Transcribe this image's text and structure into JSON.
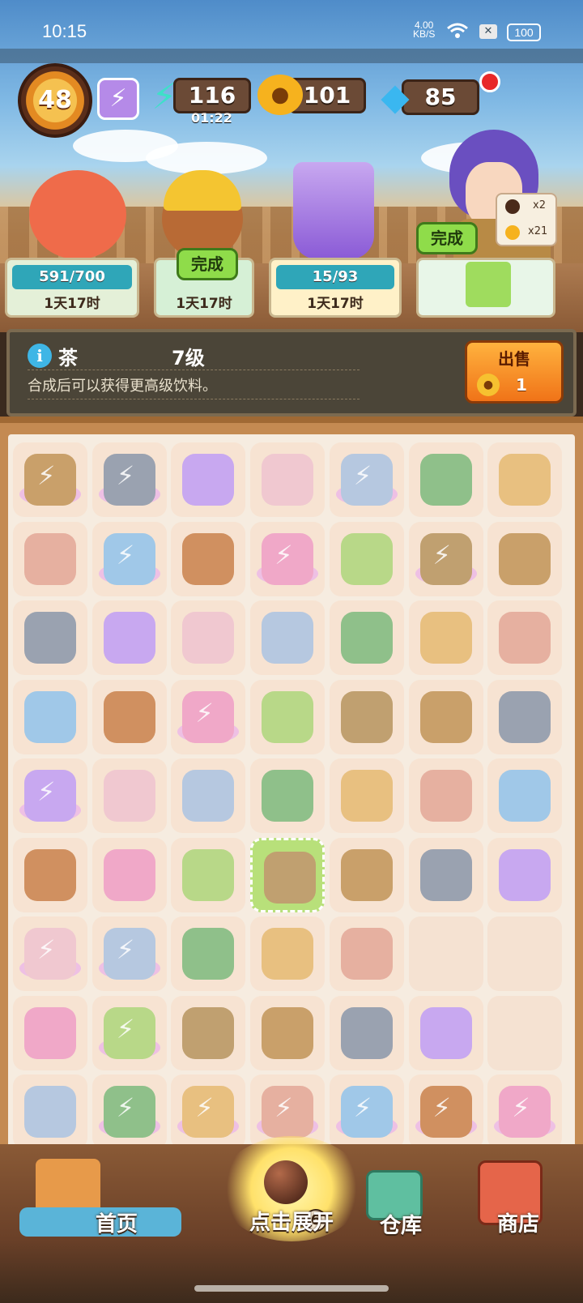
{
  "status_bar": {
    "time": "10:15",
    "net_speed": "4.00",
    "net_unit": "KB/S",
    "battery": "100"
  },
  "resources": {
    "level": "48",
    "energy": "116",
    "energy_timer": "01:22",
    "paw_coins": "101",
    "gems": "85"
  },
  "orders": {
    "chip_item_1": "x2",
    "chip_item_2": "x21",
    "done_label": "完成",
    "cards": [
      {
        "progress": "591/700",
        "time": "1天17时"
      },
      {
        "progress": "完成",
        "time": "1天17时"
      },
      {
        "progress": "15/93",
        "time": "1天17时"
      },
      {
        "progress": "",
        "time": ""
      }
    ]
  },
  "info": {
    "name": "茶",
    "level": "7级",
    "description": "合成后可以获得更高级饮料。",
    "sell_label": "出售",
    "sell_value": "1"
  },
  "board": {
    "rows": [
      [
        "wooden-bucket-generator",
        "bbq-grill-generator",
        "vending-machine",
        "cat-keychain",
        "bow-generator",
        "green-vase",
        "photo-album"
      ],
      [
        "perfume-bottle",
        "cotton-candy-generator",
        "wings",
        "bonsai-generator",
        "hand-saw",
        "wooden-tub-generator",
        "glove"
      ],
      [
        "yellow-cloth",
        "screw",
        "fox-keychain",
        "slingshot",
        "starfish",
        "metal-grill",
        "green-sack"
      ],
      [
        "chocolate-tray",
        "fish",
        "red-vending-generator",
        "battery",
        "thread-spool",
        "wood-plank",
        "string"
      ],
      [
        "paint-bucket-generator",
        "slinky",
        "wood-pieces",
        "shell",
        "cookie-pile",
        "hand-saw-2",
        "paper-scraps"
      ],
      [
        "lipstick",
        "gold-pouch",
        "rake",
        "teapot",
        "scraper",
        "paw-cookie",
        "dustpan"
      ],
      [
        "bow-generator-2",
        "pink-vending-generator",
        "axe",
        "battery-small",
        "cat-towel",
        "empty",
        "empty"
      ],
      [
        "green-sack-glow",
        "bbq-grill-generator-2",
        "fish-2",
        "crab",
        "cookie-pile-2",
        "cola-can",
        "empty"
      ],
      [
        "glass-vase",
        "sand-castle-generator",
        "cotton-candy-generator-2",
        "window-generator",
        "cotton-candy-generator-3",
        "chest-generator",
        "treasure-chest-generator"
      ]
    ],
    "selected": "teapot"
  },
  "nav": {
    "home": "首页",
    "expand": "点击展开",
    "expand_count": "6",
    "warehouse": "仓库",
    "shop": "商店"
  },
  "colors": {
    "board_bg": "#f6ece0",
    "cell_bg": "#f7e3d2",
    "selected_cell": "#b8e07a",
    "sell_button": "#f07318",
    "done_button": "#8fdc4a"
  }
}
